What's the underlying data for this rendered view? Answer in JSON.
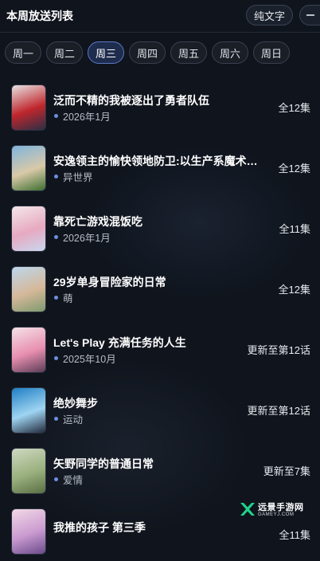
{
  "header": {
    "title": "本周放送列表",
    "text_mode_label": "纯文字",
    "more_icon": "minus-icon"
  },
  "tabs": [
    {
      "label": "周一",
      "active": false
    },
    {
      "label": "周二",
      "active": false
    },
    {
      "label": "周三",
      "active": true
    },
    {
      "label": "周四",
      "active": false
    },
    {
      "label": "周五",
      "active": false
    },
    {
      "label": "周六",
      "active": false
    },
    {
      "label": "周日",
      "active": false
    }
  ],
  "items": [
    {
      "title": "泛而不精的我被逐出了勇者队伍",
      "tag": "2026年1月",
      "episodes": "全12集",
      "poster_colors": [
        "#e7e3e2",
        "#c0262d",
        "#2a2f45"
      ]
    },
    {
      "title": "安逸领主的愉快领地防卫:以生产系魔术将无名小村打造成最强要塞都市",
      "tag": "异世界",
      "episodes": "全12集",
      "poster_colors": [
        "#7fb4dd",
        "#d9c9a8",
        "#3c6f2f"
      ]
    },
    {
      "title": "靠死亡游戏混饭吃",
      "tag": "2026年1月",
      "episodes": "全11集",
      "poster_colors": [
        "#f3e7ea",
        "#e7a9c0",
        "#c9d7f0"
      ]
    },
    {
      "title": "29岁单身冒险家的日常",
      "tag": "萌",
      "episodes": "全12集",
      "poster_colors": [
        "#bcd7ec",
        "#d6b89a",
        "#7e9a6e"
      ]
    },
    {
      "title": "Let's Play 充满任务的人生",
      "tag": "2025年10月",
      "episodes": "更新至第12话",
      "poster_colors": [
        "#f4e3e7",
        "#e88fb0",
        "#5a3d56"
      ]
    },
    {
      "title": "绝妙舞步",
      "tag": "运动",
      "episodes": "更新至第12话",
      "poster_colors": [
        "#1f7fc4",
        "#9fd4f2",
        "#222a3a"
      ]
    },
    {
      "title": "矢野同学的普通日常",
      "tag": "爱情",
      "episodes": "更新至7集",
      "poster_colors": [
        "#cfd9c2",
        "#9ab07e",
        "#5a6e44"
      ]
    },
    {
      "title": "我推的孩子 第三季",
      "tag": "",
      "episodes": "全11集",
      "poster_colors": [
        "#f3d9e6",
        "#c99ad0",
        "#6a4a8a"
      ]
    }
  ],
  "watermark": {
    "name": "远景手游网",
    "domain": "GAMEYJ.COM",
    "color": "#1fd38a"
  }
}
